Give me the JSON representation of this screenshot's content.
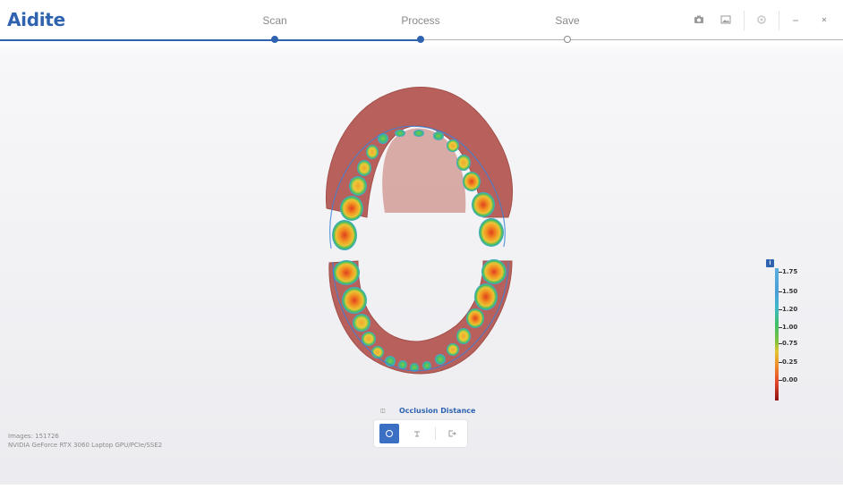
{
  "app": {
    "logo": "Aidite"
  },
  "steps": [
    {
      "label": "Scan",
      "state": "done"
    },
    {
      "label": "Process",
      "state": "current"
    },
    {
      "label": "Save",
      "state": "pending"
    }
  ],
  "toolbar_icons": [
    "camera-icon",
    "image-icon",
    "settings-icon",
    "minimize-icon",
    "close-icon"
  ],
  "colors": {
    "accent": "#2f63b0",
    "active_tool": "#3a6fc4"
  },
  "colorscale": {
    "labels": [
      "1.75",
      "1.50",
      "1.20",
      "1.00",
      "0.75",
      "0.25",
      "0.00"
    ],
    "info_glyph": "i"
  },
  "occlusion": {
    "title": "Occlusion Distance",
    "tools": [
      "circle-tool-icon",
      "align-tool-icon",
      "exit-icon"
    ]
  },
  "status": {
    "images": "Images: 151726",
    "gpu": "NVIDIA GeForce RTX 3060 Laptop GPU/PCIe/SSE2"
  }
}
